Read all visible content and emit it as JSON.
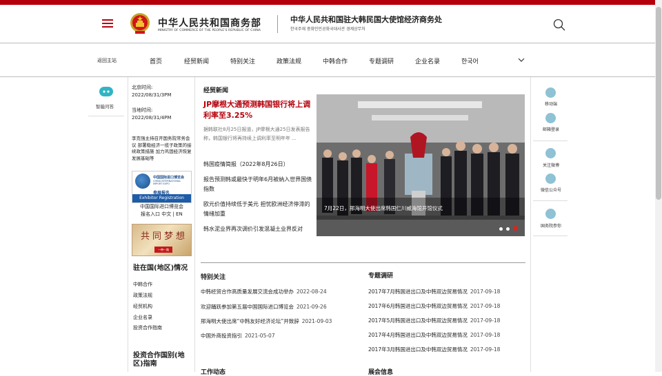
{
  "header": {
    "logo_cn": "中华人民共和国商务部",
    "logo_en": "MINISTRY OF COMMERCE OF THE PEOPLE'S REPUBLIC OF CHINA",
    "office_cn": "中华人民共和国驻大韩民国大使馆经济商务处",
    "office_kr": "한국주재 중화인민공화국대사관 경제상무처",
    "brand_color": "#b5000a"
  },
  "nav": {
    "back_label": "返回主站",
    "items": [
      "首页",
      "经贸新闻",
      "特别关注",
      "政策法规",
      "中韩合作",
      "专题调研",
      "企业名录",
      "한국어"
    ]
  },
  "left_rail": {
    "chat_label": "智能问答"
  },
  "left_col": {
    "beijing_label": "北京时间:",
    "beijing_time": "2022/08/31/3PM",
    "local_label": "当地时间:",
    "local_time": "2022/08/31/4PM",
    "notice": "李克强主持召开国务院常务会议 部署稳经济一揽子政策的接续政策措施 加力巩固经济恢复发展基础等",
    "expo_cn": "中国国际进口博览会",
    "expo_en": "CHINA INTERNATIONAL IMPORT EXPO",
    "expo_cn2": "参展报名",
    "expo_en2": "Exhibitor Registration",
    "expo_caption1": "中国国际进口博览会",
    "expo_caption2": "报名入口 中文 | EN",
    "dream_text": "共同梦想",
    "dream_sub": "一带一路",
    "region_title": "驻在国(地区)情况",
    "region_links": [
      "中韩合作",
      "政策法规",
      "经贸机构",
      "企业名录",
      "投资合作指南"
    ],
    "guide_title": "投资合作国别(地区)指南"
  },
  "trade_news": {
    "title": "经贸新闻",
    "headline": "JP摩根大通预测韩国银行将上调利率至3.25%",
    "summary": "据韩联社8月25日报道，JP摩根大通25日发表报告称，韩国银行将再持续上调利率至明年年 ...",
    "links": [
      "韩国疫情简报（2022年8月26日）",
      "报告预测韩或最快于明年6月被纳入世界国债指数",
      "欧元价值持续低于美元 担忧欧洲经济停滞的情绪加重",
      "韩水泥业界再次调价引发混凝土业界反对"
    ],
    "photo_caption": "7月22日，邢海明大使出席韩国仁川威海馆开馆仪式"
  },
  "special": {
    "title": "特别关注",
    "items": [
      {
        "text": "中韩经贸合作高质量发展交流会成功举办",
        "date": "2022-08-24"
      },
      {
        "text": "欢迎踊跃参加第五届中国国际进口博览会",
        "date": "2021-09-26"
      },
      {
        "text": "邢海明大使出席“中韩友好经济论坛”并致辞",
        "date": "2021-09-03"
      },
      {
        "text": "中国外商投资指引",
        "date": "2021-05-07"
      }
    ],
    "next_title": "工作动态"
  },
  "research": {
    "title": "专题调研",
    "items": [
      {
        "text": "2017年7月韩国进出口及中韩双边贸易情况",
        "date": "2017-09-18"
      },
      {
        "text": "2017年6月韩国进出口及中韩双边贸易情况",
        "date": "2017-09-18"
      },
      {
        "text": "2017年5月韩国进出口及中韩双边贸易情况",
        "date": "2017-09-18"
      },
      {
        "text": "2017年4月韩国进出口及中韩双边贸易情况",
        "date": "2017-09-18"
      },
      {
        "text": "2017年3月韩国进出口及中韩双边贸易情况",
        "date": "2017-09-18"
      }
    ],
    "next_title": "展会信息"
  },
  "right_rail": {
    "items": [
      "移动端",
      "邮箱登录",
      "关注微博",
      "微信公众号",
      "国务院参你"
    ]
  }
}
